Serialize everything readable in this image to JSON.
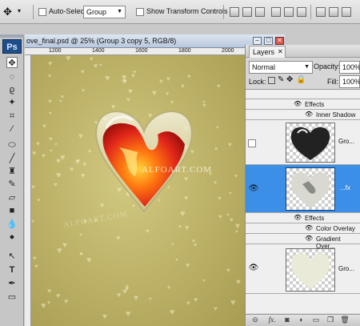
{
  "options_bar": {
    "auto_select_label": "Auto-Select:",
    "auto_select_value": "Group",
    "show_transform_label": "Show Transform Controls"
  },
  "app_logo": "Ps",
  "document": {
    "title": "ove_final.psd @ 25% (Group 3 copy 5, RGB/8)",
    "ruler_top_labels": [
      "1200",
      "1400",
      "1600",
      "1800",
      "2000"
    ],
    "watermarks": [
      "ALFOART.COM",
      "ALFOART.COM"
    ]
  },
  "layers_panel": {
    "tab_label": "Layers",
    "blend_mode": "Normal",
    "opacity_label": "Opacity:",
    "opacity_value": "100%",
    "lock_label": "Lock:",
    "fill_label": "Fill:",
    "fill_value": "100%",
    "top_effects_label": "Effects",
    "top_effect_item": "Inner Shadow",
    "layer1_name": "Gro...",
    "layer2_suffix": "...fx",
    "mid_effects_label": "Effects",
    "mid_effect_items": [
      "Color Overlay",
      "Gradient Over..."
    ],
    "layer3_name": "Gro...",
    "bottom_fx_label": "fx."
  },
  "colors": {
    "selected_layer": "#3c8fe6",
    "canvas_gold": "#bfb46a",
    "heart_red": "#e0261a"
  }
}
